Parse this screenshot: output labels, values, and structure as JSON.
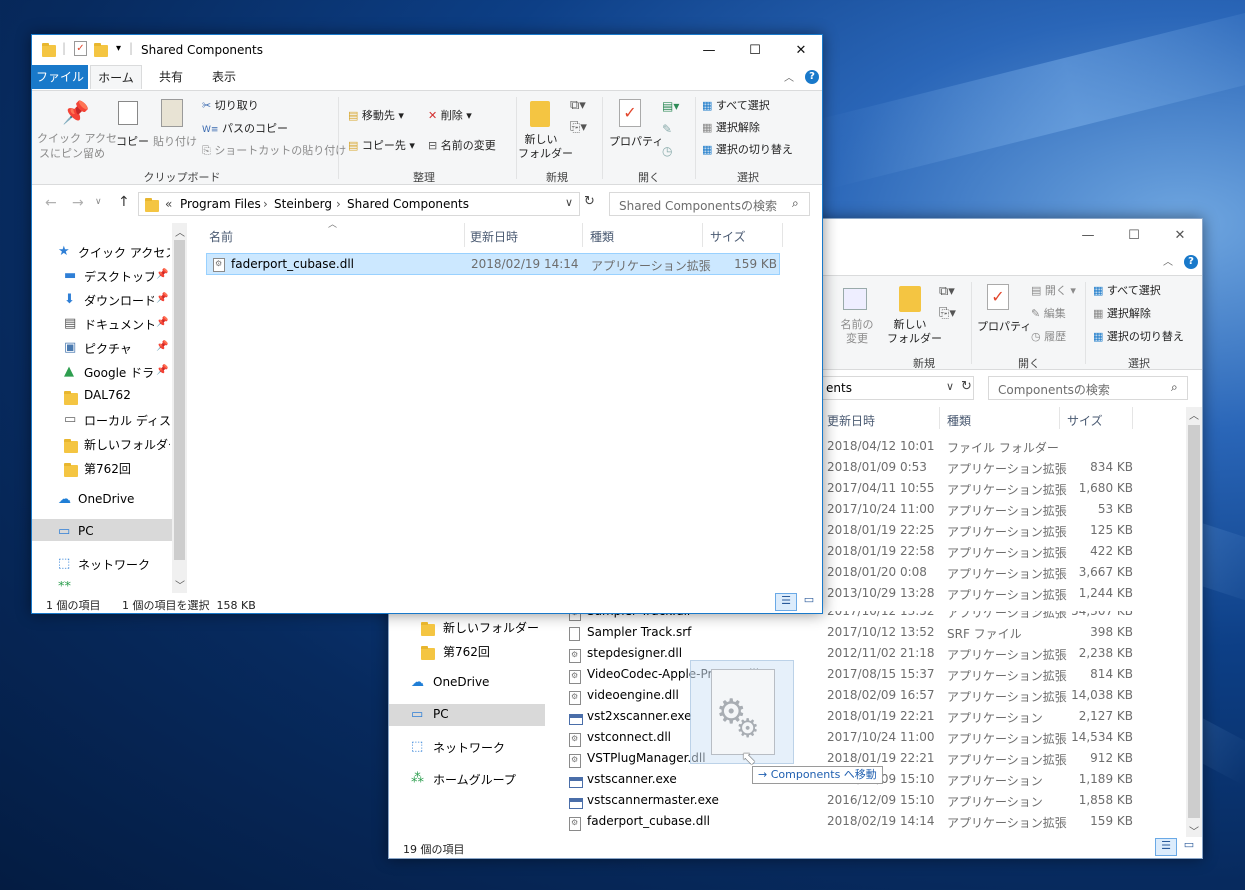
{
  "front": {
    "title": "Shared Components",
    "tabs": [
      "ファイル",
      "ホーム",
      "共有",
      "表示"
    ],
    "ribbon": {
      "pin_label_1": "クイック アクセ",
      "pin_label_2": "スにピン留め",
      "copy": "コピー",
      "paste": "貼り付け",
      "cut": "切り取り",
      "copy_path": "パスのコピー",
      "paste_shortcut": "ショートカットの貼り付け",
      "clipboard_group": "クリップボード",
      "move_to": "移動先",
      "copy_to": "コピー先",
      "delete": "削除",
      "rename": "名前の変更",
      "organize_group": "整理",
      "new_folder_1": "新しい",
      "new_folder_2": "フォルダー",
      "new_group": "新規",
      "properties": "プロパティ",
      "open_group": "開く",
      "select_all": "すべて選択",
      "select_none": "選択解除",
      "invert": "選択の切り替え",
      "select_group": "選択"
    },
    "breadcrumb": [
      "«",
      "Program Files",
      "Steinberg",
      "Shared Components"
    ],
    "search_placeholder": "Shared Componentsの検索",
    "nav": [
      {
        "label": "クイック アクセス",
        "icon": "star-icon"
      },
      {
        "label": "デスクトップ",
        "icon": "desktop-icon",
        "pinned": true
      },
      {
        "label": "ダウンロード",
        "icon": "download-icon",
        "pinned": true
      },
      {
        "label": "ドキュメント",
        "icon": "document-icon",
        "pinned": true
      },
      {
        "label": "ピクチャ",
        "icon": "picture-icon",
        "pinned": true
      },
      {
        "label": "Google ドライブ",
        "icon": "google-drive-icon",
        "pinned": true
      },
      {
        "label": "DAL762",
        "icon": "folder-icon"
      },
      {
        "label": "ローカル ディスク (F",
        "icon": "disk-icon"
      },
      {
        "label": "新しいフォルダー",
        "icon": "folder-icon"
      },
      {
        "label": "第762回",
        "icon": "folder-icon"
      },
      {
        "label": "OneDrive",
        "icon": "cloud-icon"
      },
      {
        "label": "PC",
        "icon": "pc-icon"
      },
      {
        "label": "ネットワーク",
        "icon": "network-icon"
      }
    ],
    "columns": [
      "名前",
      "更新日時",
      "種類",
      "サイズ"
    ],
    "files": [
      {
        "name": "faderport_cubase.dll",
        "date": "2018/02/19 14:14",
        "type": "アプリケーション拡張",
        "size": "159 KB"
      }
    ],
    "status_count": "1 個の項目",
    "status_selected": "1 個の項目を選択  158 KB"
  },
  "back": {
    "ribbon": {
      "rename_1": "名前の",
      "rename_2": "変更",
      "new_folder_1": "新しい",
      "new_folder_2": "フォルダー",
      "new_group": "新規",
      "properties": "プロパティ",
      "open": "開く",
      "edit": "編集",
      "history": "履歴",
      "open_group": "開く",
      "select_all": "すべて選択",
      "select_none": "選択解除",
      "invert": "選択の切り替え",
      "select_group": "選択"
    },
    "address_tail": "ents",
    "search_placeholder": "Componentsの検索",
    "columns": [
      "更新日時",
      "種類",
      "サイズ"
    ],
    "upper_rows": [
      {
        "date": "2018/04/12 10:01",
        "type": "ファイル フォルダー",
        "size": ""
      },
      {
        "date": "2018/01/09 0:53",
        "type": "アプリケーション拡張",
        "size": "834 KB"
      },
      {
        "date": "2017/04/11 10:55",
        "type": "アプリケーション拡張",
        "size": "1,680 KB"
      },
      {
        "date": "2017/10/24 11:00",
        "type": "アプリケーション拡張",
        "size": "53 KB"
      },
      {
        "date": "2018/01/19 22:25",
        "type": "アプリケーション拡張",
        "size": "125 KB"
      },
      {
        "date": "2018/01/19 22:58",
        "type": "アプリケーション拡張",
        "size": "422 KB"
      },
      {
        "date": "2018/01/20 0:08",
        "type": "アプリケーション拡張",
        "size": "3,667 KB"
      },
      {
        "date": "2013/10/29 13:28",
        "type": "アプリケーション拡張",
        "size": "1,244 KB"
      }
    ],
    "nav": [
      {
        "label": "新しいフォルダー",
        "icon": "folder-icon"
      },
      {
        "label": "第762回",
        "icon": "folder-icon"
      },
      {
        "label": "OneDrive",
        "icon": "cloud-icon"
      },
      {
        "label": "PC",
        "icon": "pc-icon"
      },
      {
        "label": "ネットワーク",
        "icon": "network-icon"
      },
      {
        "label": "ホームグループ",
        "icon": "homegroup-icon"
      }
    ],
    "files": [
      {
        "name": "Sampler Track.dll",
        "date": "2017/10/12 13:52",
        "type": "アプリケーション拡張",
        "size": "54,307 KB",
        "icon": "dll"
      },
      {
        "name": "Sampler Track.srf",
        "date": "2017/10/12 13:52",
        "type": "SRF ファイル",
        "size": "398 KB",
        "icon": "file"
      },
      {
        "name": "stepdesigner.dll",
        "date": "2012/11/02 21:18",
        "type": "アプリケーション拡張",
        "size": "2,238 KB",
        "icon": "dll"
      },
      {
        "name": "VideoCodec-Apple-ProRes.dll",
        "date": "2017/08/15 15:37",
        "type": "アプリケーション拡張",
        "size": "814 KB",
        "icon": "dll"
      },
      {
        "name": "videoengine.dll",
        "date": "2018/02/09 16:57",
        "type": "アプリケーション拡張",
        "size": "14,038 KB",
        "icon": "dll"
      },
      {
        "name": "vst2xscanner.exe",
        "date": "2018/01/19 22:21",
        "type": "アプリケーション",
        "size": "2,127 KB",
        "icon": "exe"
      },
      {
        "name": "vstconnect.dll",
        "date": "2017/10/24 11:00",
        "type": "アプリケーション拡張",
        "size": "14,534 KB",
        "icon": "dll"
      },
      {
        "name": "VSTPlugManager.dll",
        "date": "2018/01/19 22:21",
        "type": "アプリケーション拡張",
        "size": "912 KB",
        "icon": "dll"
      },
      {
        "name": "vstscanner.exe",
        "date": "2016/12/09 15:10",
        "type": "アプリケーション",
        "size": "1,189 KB",
        "icon": "exe"
      },
      {
        "name": "vstscannermaster.exe",
        "date": "2016/12/09 15:10",
        "type": "アプリケーション",
        "size": "1,858 KB",
        "icon": "exe"
      },
      {
        "name": "faderport_cubase.dll",
        "date": "2018/02/19 14:14",
        "type": "アプリケーション拡張",
        "size": "159 KB",
        "icon": "dll"
      }
    ],
    "status_count": "19 個の項目"
  },
  "drag": {
    "ghost_label": "VideoCodec-Apple-ProRes.dll",
    "tooltip": "Components へ移動"
  },
  "colors": {
    "accent": "#1979ca",
    "selection": "#cce8ff",
    "selection_border": "#99d1ff",
    "nav_selected": "#d9d9d9"
  }
}
